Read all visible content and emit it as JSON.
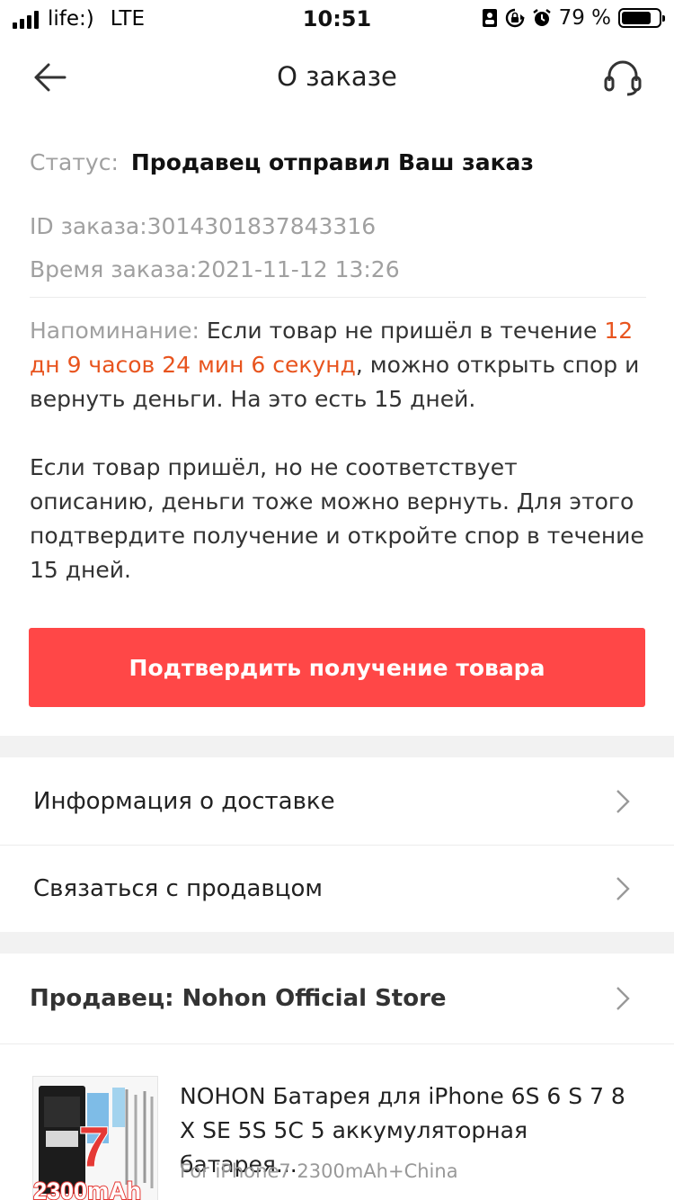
{
  "status_bar": {
    "carrier": "life:)",
    "network": "LTE",
    "time": "10:51",
    "battery_percent": "79 %",
    "battery_level": 0.79,
    "icons": [
      "signal-icon",
      "orientation-lock-icon",
      "alarm-icon",
      "battery-icon"
    ]
  },
  "nav": {
    "title": "О заказе",
    "back_icon": "arrow-left-icon",
    "support_icon": "headset-icon"
  },
  "order": {
    "status_label": "Статус:",
    "status_value": "Продавец отправил Ваш заказ",
    "id_label": "ID заказа:",
    "id_value": "3014301837843316",
    "time_label": "Время заказа:",
    "time_value": "2021-11-12 13:26",
    "reminder_label": "Напоминание:",
    "reminder_text_1": " Если товар не пришёл в течение ",
    "countdown": "12 дн 9 часов 24 мин 6 секунд",
    "reminder_text_2": ", можно открыть спор и вернуть деньги. На это есть 15 дней.",
    "note": "Если товар пришёл, но не соответствует описанию, деньги тоже можно вернуть. Для этого подтвердите получение и откройте спор в течение 15 дней.",
    "confirm_button": "Подтвердить получение товара"
  },
  "links": {
    "delivery_info": "Информация о доставке",
    "contact_seller": "Связаться с продавцом"
  },
  "seller": {
    "label": "Продавец: Nohon Official Store"
  },
  "product": {
    "title": "NOHON Батарея для iPhone 6S 6 S 7 8 X SE 5S 5C 5 аккумуляторная батарея...",
    "sku": "For iPhone7 2300mAh+China",
    "thumb_model": "7",
    "thumb_capacity": "2300mAh"
  },
  "colors": {
    "accent": "#ff4747",
    "countdown": "#e8541e",
    "muted": "#a0a0a0",
    "section_gap": "#f2f2f2"
  }
}
